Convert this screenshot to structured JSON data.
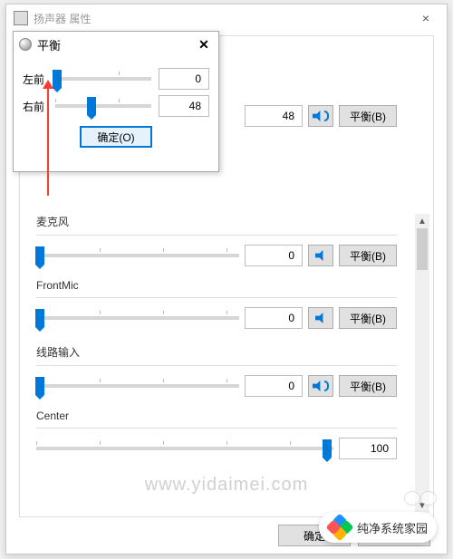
{
  "main": {
    "title": "扬声器 属性",
    "ok": "确定",
    "cancel": "取消"
  },
  "row_top": {
    "value": "48",
    "balance": "平衡(B)"
  },
  "groups": {
    "mic": {
      "label": "麦克风",
      "value": "0",
      "balance": "平衡(B)",
      "thumb_pct": 2,
      "muted": true
    },
    "front": {
      "label": "FrontMic",
      "value": "0",
      "balance": "平衡(B)",
      "thumb_pct": 2,
      "muted": true
    },
    "line": {
      "label": "线路输入",
      "value": "0",
      "balance": "平衡(B)",
      "thumb_pct": 2,
      "muted": false
    },
    "center": {
      "label": "Center",
      "value": "100",
      "thumb_pct": 98
    }
  },
  "balance": {
    "title": "平衡",
    "left_label": "左前",
    "right_label": "右前",
    "left_value": "0",
    "right_value": "48",
    "left_thumb_pct": 2,
    "right_thumb_pct": 38,
    "ok": "确定(O)"
  },
  "watermark": "www.yidaimei.com",
  "logo_text": "纯净系统家园"
}
